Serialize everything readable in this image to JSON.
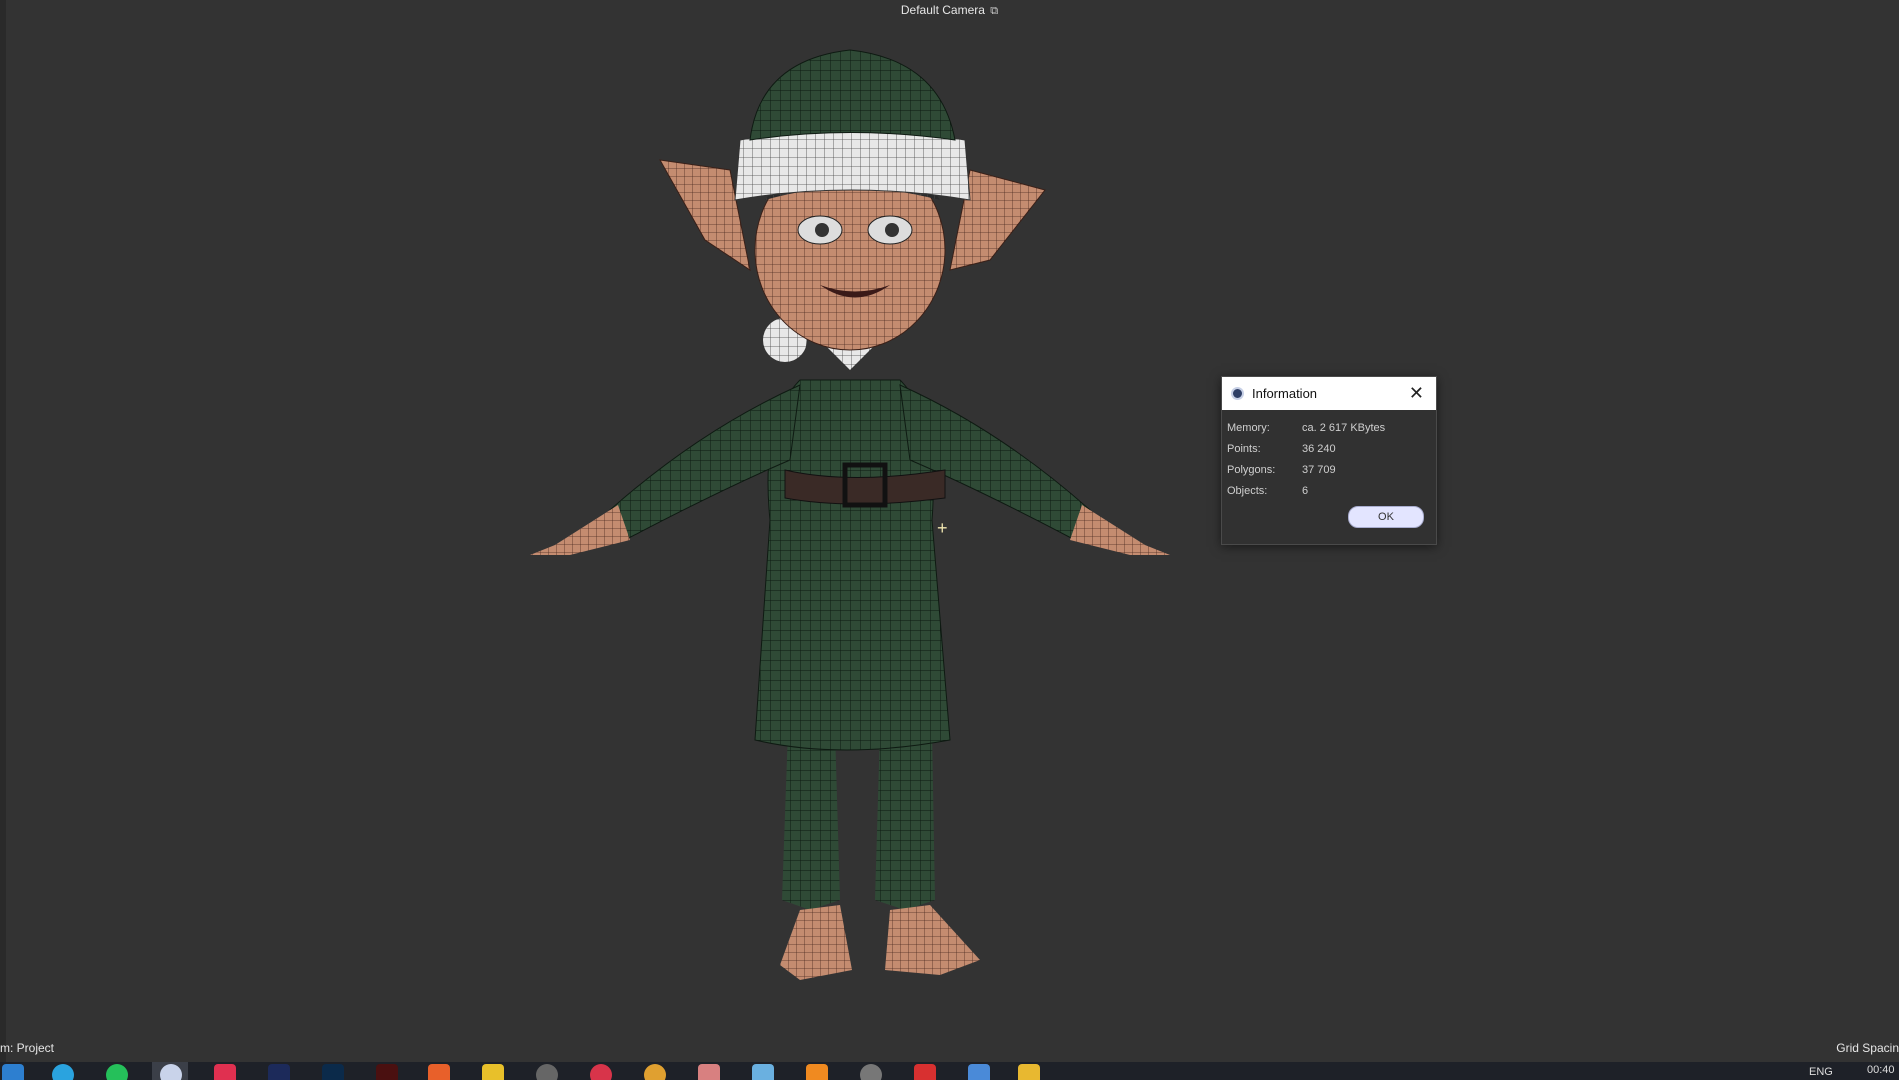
{
  "viewport": {
    "camera_label": "Default Camera",
    "camera_icon": "camera-lock-icon",
    "status_left": "m: Project",
    "status_right": "Grid Spacin"
  },
  "dialog": {
    "title": "Information",
    "app_icon": "cinema4d-logo-icon",
    "close_icon": "close-icon",
    "rows": [
      {
        "label": "Memory:",
        "value": "ca. 2 617 KBytes"
      },
      {
        "label": "Points:",
        "value": "36 240"
      },
      {
        "label": "Polygons:",
        "value": "37 709"
      },
      {
        "label": "Objects:",
        "value": "6"
      }
    ],
    "ok_label": "OK"
  },
  "taskbar": {
    "language": "ENG",
    "time": "00:40",
    "icons": [
      "start-icon",
      "telegram-icon",
      "whatsapp-icon",
      "cinema4d-icon",
      "app-icon",
      "after-effects-icon",
      "photoshop-icon",
      "illustrator-icon",
      "office-icon",
      "app-icon",
      "obs-icon",
      "opera-icon",
      "chrome-icon",
      "app-icon",
      "app-icon",
      "sublime-icon",
      "app-icon",
      "app-icon",
      "app-icon",
      "folder-icon"
    ]
  },
  "colors": {
    "viewport_bg": "#333333",
    "taskbar_bg": "#1e2128",
    "mesh_green": "#2f4a36",
    "skin": "#c89478"
  }
}
